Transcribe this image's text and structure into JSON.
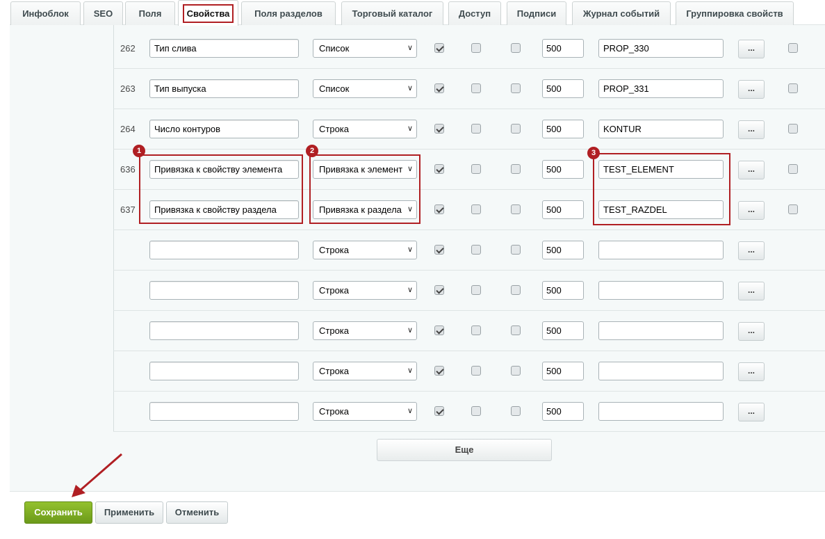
{
  "tabs": [
    {
      "label": "Инфоблок",
      "active": false
    },
    {
      "label": "SEO",
      "active": false
    },
    {
      "label": "Поля",
      "active": false
    },
    {
      "label": "Свойства",
      "active": true
    },
    {
      "label": "Поля разделов",
      "active": false
    },
    {
      "label": "Торговый каталог",
      "active": false
    },
    {
      "label": "Доступ",
      "active": false
    },
    {
      "label": "Подписи",
      "active": false
    },
    {
      "label": "Журнал событий",
      "active": false
    },
    {
      "label": "Группировка свойств",
      "active": false
    }
  ],
  "rows": [
    {
      "id": "262",
      "name": "Тип слива",
      "type": "Список",
      "active": true,
      "multiple": false,
      "required": false,
      "sort": "500",
      "code": "PROP_330",
      "has_delete": true
    },
    {
      "id": "263",
      "name": "Тип выпуска",
      "type": "Список",
      "active": true,
      "multiple": false,
      "required": false,
      "sort": "500",
      "code": "PROP_331",
      "has_delete": true
    },
    {
      "id": "264",
      "name": "Число контуров",
      "type": "Строка",
      "active": true,
      "multiple": false,
      "required": false,
      "sort": "500",
      "code": "KONTUR",
      "has_delete": true
    },
    {
      "id": "636",
      "name": "Привязка к свойству элемента",
      "type": "Привязка к элемент",
      "active": true,
      "multiple": false,
      "required": false,
      "sort": "500",
      "code": "TEST_ELEMENT",
      "has_delete": true
    },
    {
      "id": "637",
      "name": "Привязка к свойству раздела",
      "type": "Привязка к раздела",
      "active": true,
      "multiple": false,
      "required": false,
      "sort": "500",
      "code": "TEST_RAZDEL",
      "has_delete": true
    },
    {
      "id": "",
      "name": "",
      "type": "Строка",
      "active": true,
      "multiple": false,
      "required": false,
      "sort": "500",
      "code": "",
      "has_delete": false
    },
    {
      "id": "",
      "name": "",
      "type": "Строка",
      "active": true,
      "multiple": false,
      "required": false,
      "sort": "500",
      "code": "",
      "has_delete": false
    },
    {
      "id": "",
      "name": "",
      "type": "Строка",
      "active": true,
      "multiple": false,
      "required": false,
      "sort": "500",
      "code": "",
      "has_delete": false
    },
    {
      "id": "",
      "name": "",
      "type": "Строка",
      "active": true,
      "multiple": false,
      "required": false,
      "sort": "500",
      "code": "",
      "has_delete": false
    },
    {
      "id": "",
      "name": "",
      "type": "Строка",
      "active": true,
      "multiple": false,
      "required": false,
      "sort": "500",
      "code": "",
      "has_delete": false
    }
  ],
  "dots_label": "...",
  "more_button": "Еще",
  "badges": [
    "1",
    "2",
    "3"
  ],
  "footer": {
    "save": "Сохранить",
    "apply": "Применить",
    "cancel": "Отменить"
  },
  "colors": {
    "highlight": "#b01f23",
    "save_button": "#7fad22"
  }
}
